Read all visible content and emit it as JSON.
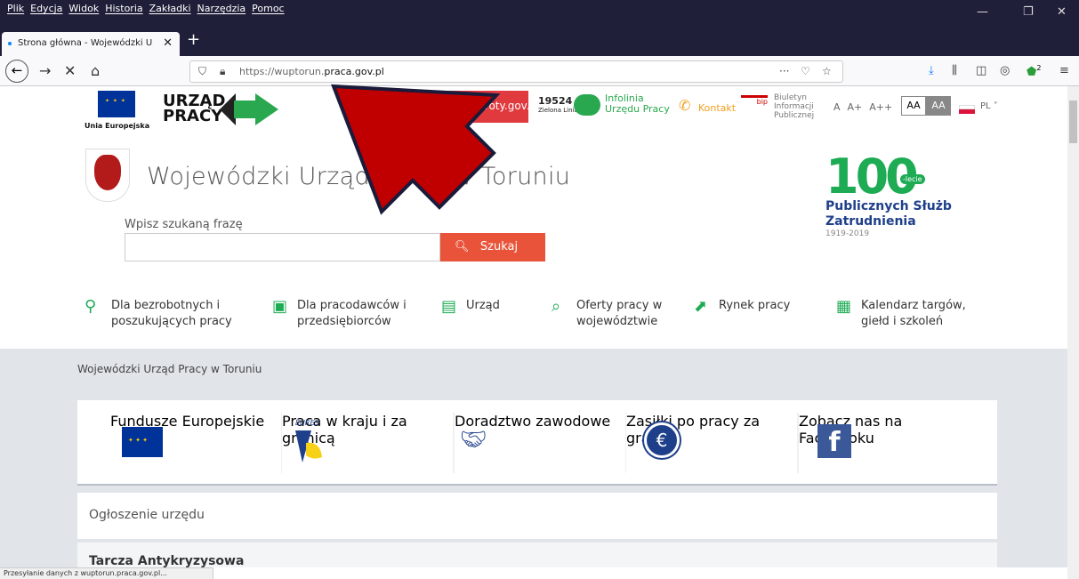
{
  "browser": {
    "menu": [
      "Plik",
      "Edycja",
      "Widok",
      "Historia",
      "Zakładki",
      "Narzędzia",
      "Pomoc"
    ],
    "tab_title": "Strona główna - Wojewódzki U",
    "url_prefix": "https://wuptorun.",
    "url_domain": "praca.gov.pl",
    "status": "Przesyłanie danych z wuptorun.praca.gov.pl...",
    "download_badge": "2"
  },
  "header": {
    "eu_label": "Unia Europejska",
    "up_logo_line1": "URZĄD",
    "up_logo_line2": "PRACY",
    "powroty": "powroty.gov.pl",
    "zl_number": "19524",
    "zl_name": "Zielona Linia",
    "infolinia_line1": "Infolinia",
    "infolinia_line2": "Urzędu Pracy",
    "kontakt": "Kontakt",
    "bip_tag": "bip",
    "bip_line1": "Biuletyn",
    "bip_line2": "Informacji",
    "bip_line3": "Publicznej",
    "font_a": "A",
    "font_a_plus": "A+",
    "font_a_plusplus": "A++",
    "contrast_normal": "AA",
    "contrast_high": "AA",
    "lang": "PL ˅"
  },
  "site": {
    "title": "Wojewódzki Urząd Pracy w Toruniu",
    "search_label": "Wpisz szukaną frazę",
    "search_button": "Szukaj",
    "badge_num": "100",
    "badge_lecie": "-lecie",
    "badge_line1": "Publicznych Służb",
    "badge_line2": "Zatrudnienia",
    "badge_years": "1919-2019"
  },
  "nav": [
    {
      "line1": "Dla bezrobotnych i",
      "line2": "poszukujących pracy"
    },
    {
      "line1": "Dla pracodawców i",
      "line2": "przedsiębiorców"
    },
    {
      "line1": "Urząd",
      "line2": ""
    },
    {
      "line1": "Oferty pracy w",
      "line2": "województwie"
    },
    {
      "line1": "Rynek pracy",
      "line2": ""
    },
    {
      "line1": "Kalendarz targów,",
      "line2": "giełd i szkoleń"
    }
  ],
  "breadcrumb": "Wojewódzki Urząd Pracy w Toruniu",
  "tiles": [
    {
      "l1": "Fundusze",
      "l2": "Europejskie",
      "l3": ""
    },
    {
      "l1": "Praca w kraju",
      "l2": "i za granicą",
      "l3": "",
      "tag": "EURES"
    },
    {
      "l1": "Doradztwo",
      "l2": "zawodowe",
      "l3": ""
    },
    {
      "l1": "Zasiłki",
      "l2": "po pracy",
      "l3": "za granicą"
    },
    {
      "l1": "Zobacz nas na",
      "l2": "Facebooku",
      "l3": ""
    }
  ],
  "announcement_title": "Ogłoszenie urzędu",
  "news_title": "Tarcza Antykryzysowa"
}
